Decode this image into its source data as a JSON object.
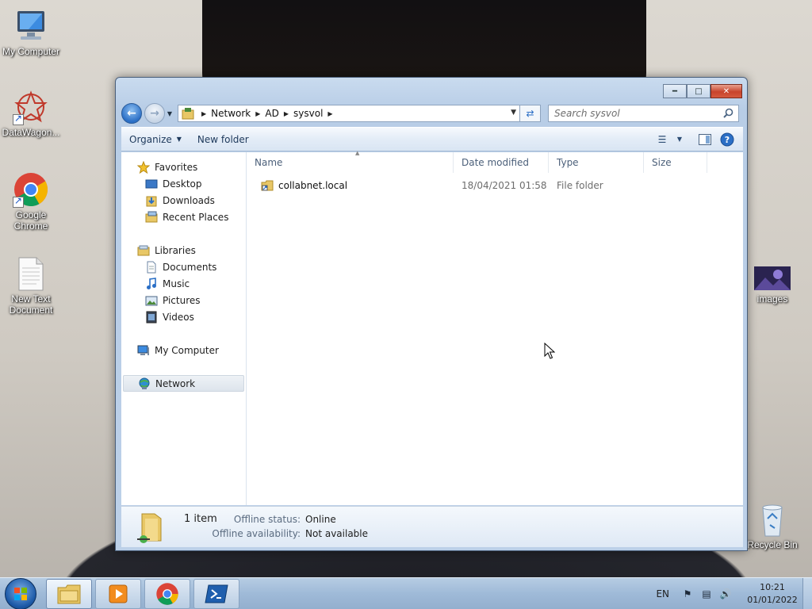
{
  "desktop": {
    "icons": [
      {
        "label": "My Computer",
        "icon": "my-computer-icon"
      },
      {
        "label": "DataWagon...",
        "icon": "datawagon-icon",
        "shortcut": true
      },
      {
        "label": "Google Chrome",
        "icon": "chrome-icon",
        "shortcut": true
      },
      {
        "label": "New Text Document",
        "icon": "text-document-icon"
      },
      {
        "label": "images",
        "icon": "image-thumbnail-icon"
      },
      {
        "label": "Recycle Bin",
        "icon": "recycle-bin-icon"
      }
    ]
  },
  "window": {
    "controls": {
      "minimize": "minimize-icon",
      "maximize": "maximize-icon",
      "close": "close-icon"
    },
    "breadcrumb": [
      "Network",
      "AD",
      "sysvol"
    ],
    "search": {
      "placeholder": "Search sysvol"
    },
    "commands": {
      "organize": "Organize",
      "new_folder": "New folder"
    },
    "navigation": {
      "favorites": {
        "label": "Favorites",
        "items": [
          "Desktop",
          "Downloads",
          "Recent Places"
        ]
      },
      "libraries": {
        "label": "Libraries",
        "items": [
          "Documents",
          "Music",
          "Pictures",
          "Videos"
        ]
      },
      "computer": "My Computer",
      "network": "Network",
      "selected": "Network"
    },
    "columns": [
      "Name",
      "Date modified",
      "Type",
      "Size"
    ],
    "files": [
      {
        "name": "collabnet.local",
        "date_modified": "18/04/2021 01:58",
        "type": "File folder",
        "size": ""
      }
    ],
    "details": {
      "count": "1 item",
      "offline_status_label": "Offline status:",
      "offline_status_value": "Online",
      "offline_availability_label": "Offline availability:",
      "offline_availability_value": "Not available"
    }
  },
  "taskbar": {
    "pinned": [
      "start-orb-icon",
      "explorer-icon",
      "media-player-icon",
      "chrome-icon",
      "powershell-icon"
    ],
    "language": "EN",
    "time": "10:21",
    "date": "01/01/2022"
  },
  "colors": {
    "accent": "#2b6fc6",
    "taskbar": "#9fbad8",
    "folder": "#e8c766"
  }
}
